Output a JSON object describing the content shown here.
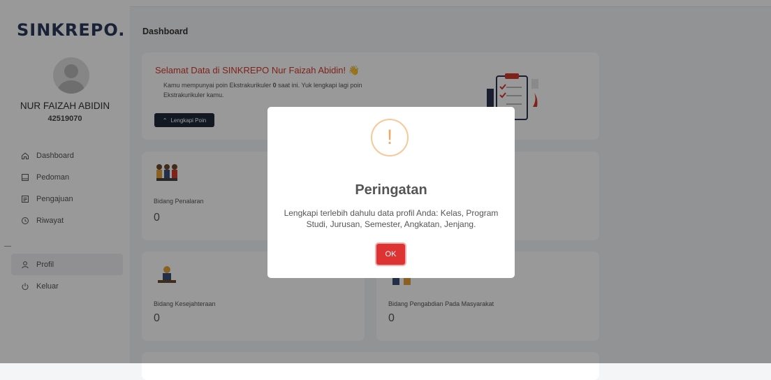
{
  "app": {
    "brand": "SINKREPO."
  },
  "user": {
    "name": "NUR FAIZAH ABIDIN",
    "id": "42519070"
  },
  "sidebar": {
    "items": [
      {
        "label": "Dashboard",
        "icon": "home-icon"
      },
      {
        "label": "Pedoman",
        "icon": "book-icon"
      },
      {
        "label": "Pengajuan",
        "icon": "document-icon"
      },
      {
        "label": "Riwayat",
        "icon": "history-icon"
      },
      {
        "label": "Profil",
        "icon": "user-icon"
      },
      {
        "label": "Keluar",
        "icon": "power-icon"
      }
    ]
  },
  "main": {
    "title": "Dashboard",
    "welcome": {
      "title": "Selamat Data di SINKREPO Nur Faizah Abidin! ",
      "wave": "👋",
      "text_pre": "Kamu mempunyai poin Ekstrakurikuler ",
      "points": "0",
      "text_post": " saat ini. Yuk lengkapi lagi poin Ekstrakurikuler kamu.",
      "button": "Lengkapi Poin"
    },
    "stats": [
      {
        "title": "Bidang Penalaran",
        "value": "0"
      },
      {
        "title": "Bidang Kesejahteraan",
        "value": "0"
      },
      {
        "title": "Bidang Pengabdian Pada Masyarakat",
        "value": "0"
      }
    ]
  },
  "modal": {
    "icon": "!",
    "title": "Peringatan",
    "text": "Lengkapi terlebih dahulu data profil Anda: Kelas, Program Studi, Jurusan, Semester, Angkatan, Jenjang.",
    "ok": "OK"
  },
  "colors": {
    "ok_button": "#dd3333",
    "warning": "#f0a86a",
    "accent_text": "#d33a2c",
    "brand": "#2b3a5c"
  }
}
